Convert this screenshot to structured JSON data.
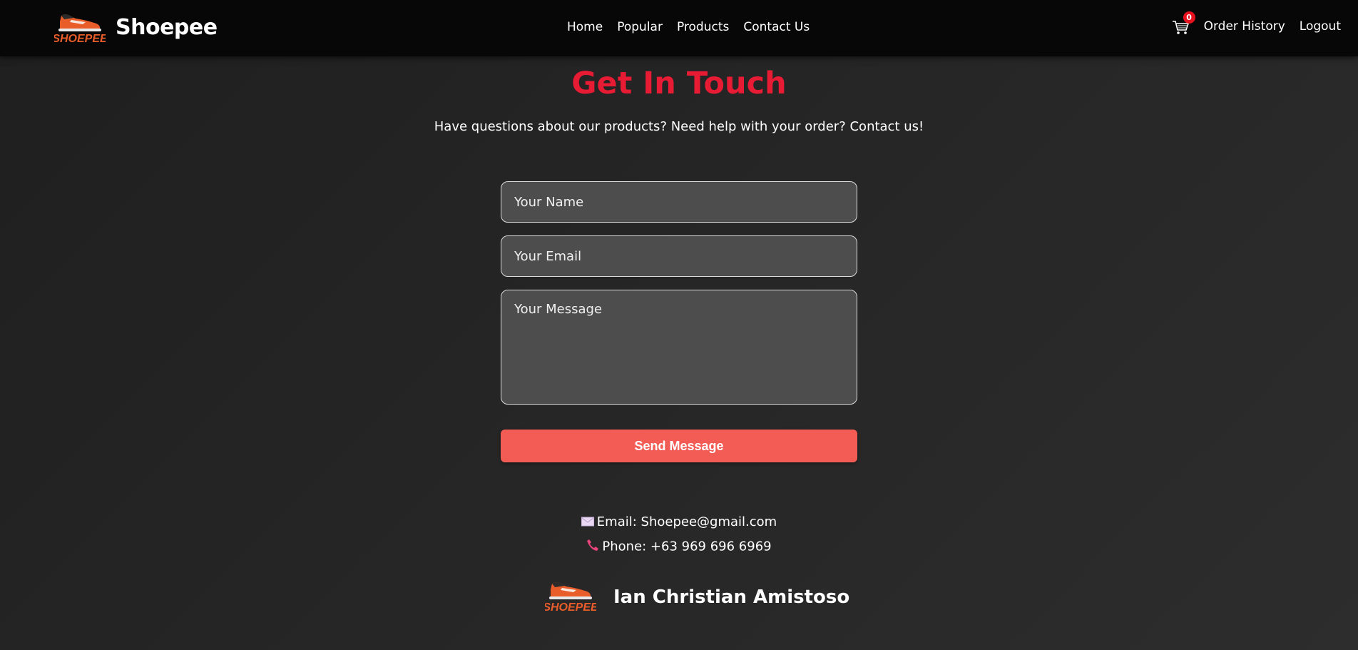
{
  "brand": {
    "name": "Shoepee",
    "logo_text": "SHOEPEE",
    "logo_color": "#e85d2a"
  },
  "nav": {
    "links": [
      "Home",
      "Popular",
      "Products",
      "Contact Us"
    ],
    "cart_icon": "cart-icon",
    "cart_count": "0",
    "order_history": "Order History",
    "logout": "Logout"
  },
  "page": {
    "title": "Get In Touch",
    "subtitle": "Have questions about our products? Need help with your order? Contact us!",
    "title_color": "#e81b34"
  },
  "form": {
    "name_placeholder": "Your Name",
    "email_placeholder": "Your Email",
    "message_placeholder": "Your Message",
    "send_label": "Send Message",
    "button_color": "#f25c54"
  },
  "contact": {
    "email": "Email: Shoepee@gmail.com",
    "phone": "Phone: +63 969 696 6969",
    "email_icon": "envelope-icon",
    "phone_icon": "phone-icon"
  },
  "footer": {
    "author": "Ian Christian Amistoso",
    "logo_text": "SHOEPEE"
  }
}
